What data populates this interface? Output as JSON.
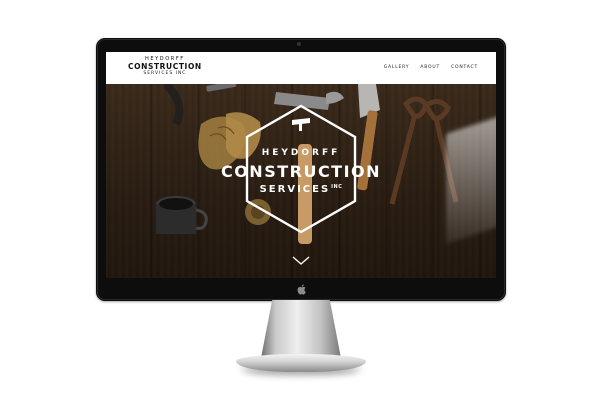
{
  "site": {
    "brand": {
      "line1": "HEYDORFF",
      "line2": "CONSTRUCTION",
      "line3": "SERVICES INC"
    },
    "nav": [
      "GALLERY",
      "ABOUT",
      "CONTACT"
    ]
  },
  "hero": {
    "logo": {
      "heydorff": "HEYDORFF",
      "construction": "CONSTRUCTION",
      "services": "SERVICES",
      "inc": "INC"
    }
  },
  "colors": {
    "screen_bg": "#2c2116",
    "header_bg": "#ffffff",
    "logo_text": "#ffffff",
    "bezel": "#0d0d0d"
  },
  "icons": [
    "apple-logo-icon",
    "chevron-down-icon",
    "hammer-icon"
  ]
}
